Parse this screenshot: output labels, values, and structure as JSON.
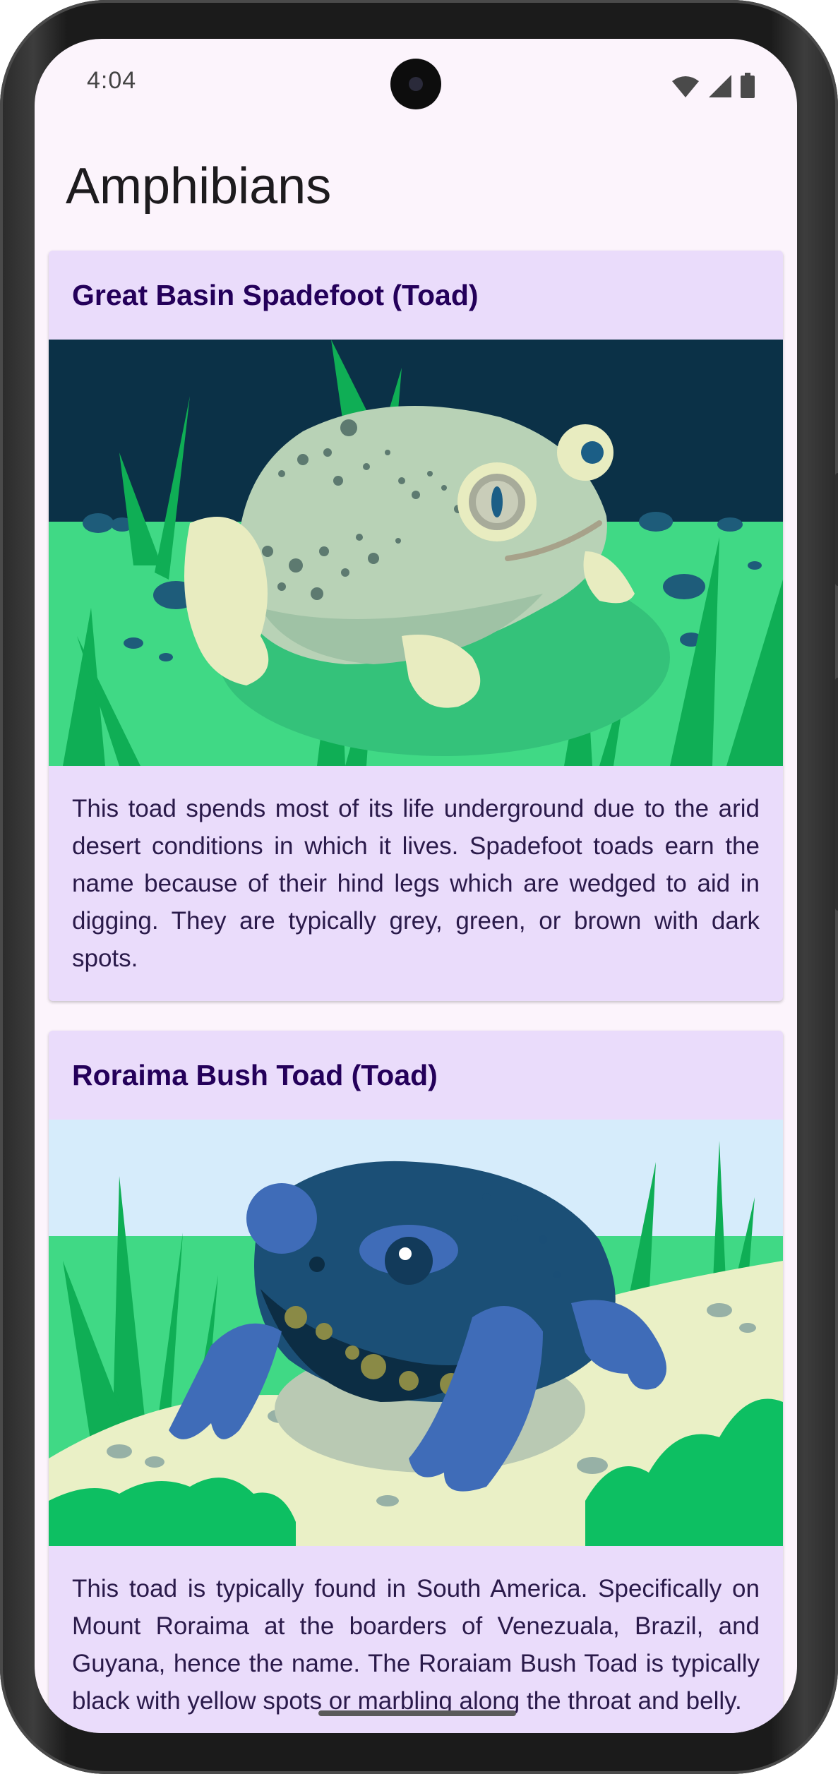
{
  "status_bar": {
    "time": "4:04",
    "icons": [
      "wifi-icon",
      "cellular-signal-icon",
      "battery-icon"
    ]
  },
  "app": {
    "title": "Amphibians"
  },
  "amphibians": [
    {
      "name": "Great Basin Spadefoot (Toad)",
      "description": "This toad spends most of its life underground due to the arid desert conditions in which it lives. Spadefoot toads earn the name because of their hind legs which are wedged to aid in digging. They are typically grey, green, or brown with dark spots."
    },
    {
      "name": "Roraima Bush Toad (Toad)",
      "description": "This toad is typically found in South America. Specifically on Mount Roraima at the boarders of Venezuala, Brazil, and Guyana, hence the name. The Roraiam Bush Toad is typically black with yellow spots or marbling along the throat and belly."
    }
  ],
  "colors": {
    "background": "#fcf4fc",
    "card_background": "#eadcfb",
    "card_title": "#24005a",
    "card_text": "#2a1a4a"
  }
}
